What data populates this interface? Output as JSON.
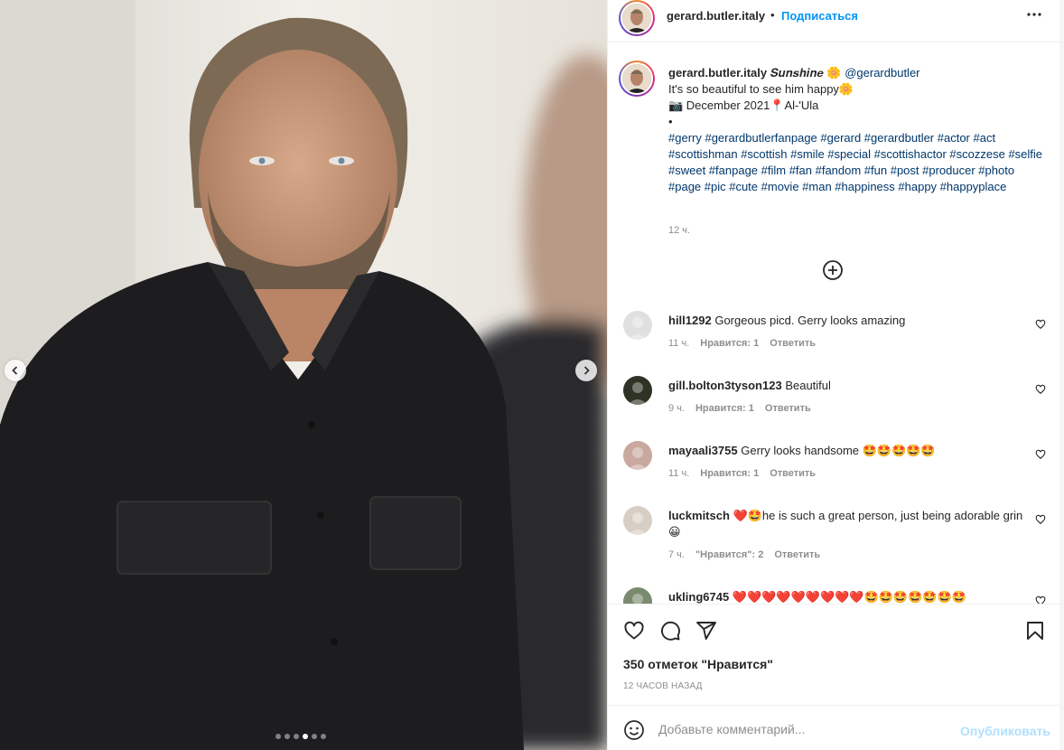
{
  "post": {
    "username": "gerard.butler.italy",
    "follow_label": "Подписаться",
    "separator": "•",
    "caption": {
      "username": "gerard.butler.italy",
      "styled_name": "𝑺𝒖𝒏𝒔𝒉𝒊𝒏𝒆 🌼",
      "mention": "@gerardbutler",
      "line1": "It's so beautiful to see him happy🌼",
      "line2": "📷 December 2021📍Al-'Ula",
      "line3": "•",
      "hashtags": "#gerry #gerardbutlerfanpage #gerard #gerardbutler #actor #act #scottishman #scottish #smile #special #scottishactor #scozzese #selfie #sweet #fanpage #film #fan #fandom #fun #post #producer #photo #page #pic #cute #movie #man #happiness #happy #happyplace",
      "time": "12 ч."
    },
    "carousel": {
      "total": 6,
      "active": 4
    }
  },
  "comments": [
    {
      "username": "hill1292",
      "text": "Gorgeous picd. Gerry looks amazing",
      "time": "11 ч.",
      "likes": "Нравится: 1",
      "reply": "Ответить",
      "avatar_color": "#e0e0e0"
    },
    {
      "username": "gill.bolton3tyson123",
      "text": "Beautiful",
      "time": "9 ч.",
      "likes": "Нравится: 1",
      "reply": "Ответить",
      "avatar_color": "#2f3326"
    },
    {
      "username": "mayaali3755",
      "text": "Gerry looks handsome 🤩🤩🤩🤩🤩",
      "time": "11 ч.",
      "likes": "Нравится: 1",
      "reply": "Ответить",
      "avatar_color": "#c9a89f"
    },
    {
      "username": "luckmitsch",
      "text": "❤️🤩he is such a great person, just being adorable grin 😀",
      "time": "7 ч.",
      "likes": "\"Нравится\": 2",
      "reply": "Ответить",
      "avatar_color": "#d8cfc4"
    },
    {
      "username": "ukling6745",
      "text": "❤️❤️❤️❤️❤️❤️❤️❤️❤️🤩🤩🤩🤩🤩🤩🤩",
      "avatar_color": "#7a8a6e"
    }
  ],
  "actions": {
    "like_icon": "heart-icon",
    "comment_icon": "comment-icon",
    "share_icon": "send-icon",
    "save_icon": "bookmark-icon",
    "likes_count": "350 отметок \"Нравится\"",
    "post_time": "12 часов назад"
  },
  "add_comment": {
    "placeholder": "Добавьте комментарий...",
    "publish_label": "Опубликовать"
  },
  "colors": {
    "link": "#0095f6",
    "hashtag": "#00376b",
    "muted": "#8e8e8e",
    "publish_disabled": "#b2dffc"
  }
}
